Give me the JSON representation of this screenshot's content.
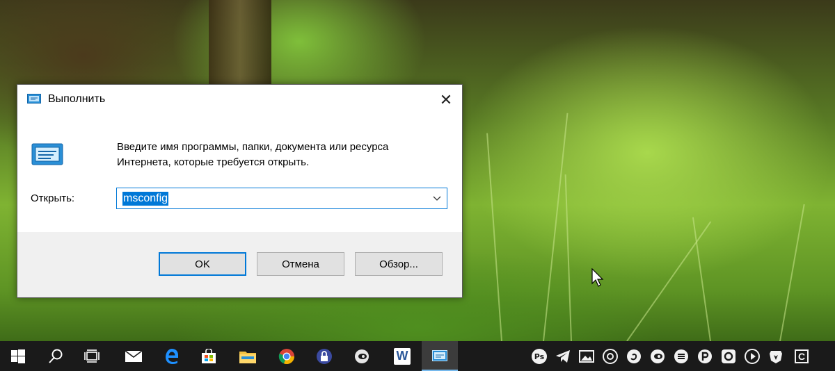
{
  "dialog": {
    "title": "Выполнить",
    "prompt_line1": "Введите имя программы, папки, документа или ресурса",
    "prompt_line2": "Интернета, которые требуется открыть.",
    "open_label": "Открыть:",
    "input_value": "msconfig",
    "ok_label": "OK",
    "cancel_label": "Отмена",
    "browse_label": "Обзор...",
    "close_glyph": "✕"
  },
  "taskbar": {
    "items": [
      "start-icon",
      "search-icon",
      "task-view-icon",
      "mail-icon",
      "edge-icon",
      "store-icon",
      "file-explorer-icon",
      "chrome-icon",
      "keepass-icon",
      "app-icon",
      "word-icon",
      "run-icon"
    ],
    "word_letter": "W",
    "tray": [
      "Ps",
      "C"
    ]
  },
  "colors": {
    "accent": "#0078d7",
    "taskbar": "#1a1a1a",
    "footer": "#f0f0f0"
  }
}
